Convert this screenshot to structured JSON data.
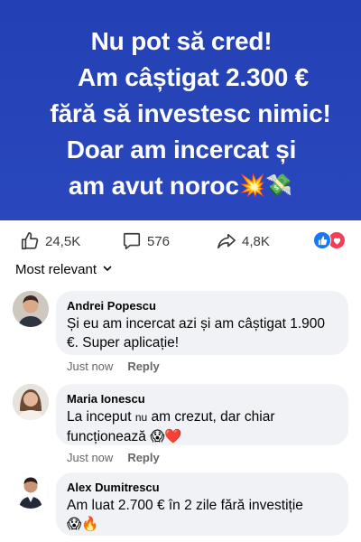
{
  "banner": {
    "lines": [
      "Nu pot să cred!",
      "Am câștigat 2.300 €",
      "fără să investesc nimic!",
      "Doar am incercat și",
      "am avut noroc"
    ],
    "emojis": [
      "💥",
      "💸"
    ]
  },
  "actions": {
    "likes": "24,5K",
    "comments": "576",
    "shares": "4,8K"
  },
  "sort_label": "Most relevant",
  "comments": [
    {
      "author": "Andrei Popescu",
      "text": "Și eu am incercat azi și am câștigat 1.900 €. Super aplicație!",
      "time": "Just now",
      "reply": "Reply"
    },
    {
      "author": "Maria Ionescu",
      "text_before": "La inceput ",
      "text_small": "nu",
      "text_after": " am crezut, dar chiar funcționează",
      "emojis": "😱❤️",
      "time": "Just now",
      "reply": "Reply"
    },
    {
      "author": "Alex Dumitrescu",
      "text": "Am luat 2.700 € în 2  zile fără investiție",
      "emojis": "😱🔥"
    }
  ],
  "colors": {
    "banner": "#2a47bd",
    "like_blue": "#1877f2",
    "love_red": "#f33e58",
    "bubble": "#f0f2f5"
  }
}
